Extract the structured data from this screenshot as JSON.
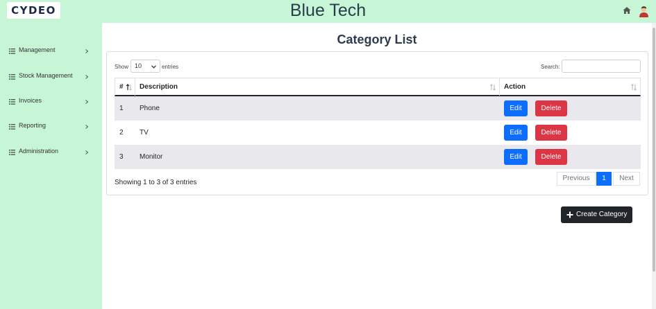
{
  "header": {
    "logo_text": "CYDEO",
    "app_title": "Blue Tech",
    "icons": [
      "home-icon",
      "user-avatar-icon"
    ]
  },
  "sidebar": {
    "items": [
      {
        "label": "Management",
        "icon": "list-icon"
      },
      {
        "label": "Stock Management",
        "icon": "list-icon"
      },
      {
        "label": "Invoices",
        "icon": "list-icon"
      },
      {
        "label": "Reporting",
        "icon": "list-icon"
      },
      {
        "label": "Administration",
        "icon": "list-icon"
      }
    ]
  },
  "main": {
    "page_title": "Category List",
    "length_menu": {
      "show_label": "Show",
      "selected": "10",
      "entries_label": "entries"
    },
    "search": {
      "label": "Search:",
      "value": "",
      "placeholder": ""
    },
    "table": {
      "columns": [
        "#",
        "Description",
        "Action"
      ],
      "rows": [
        {
          "id": "1",
          "description": "Phone"
        },
        {
          "id": "2",
          "description": "TV"
        },
        {
          "id": "3",
          "description": "Monitor"
        }
      ],
      "edit_label": "Edit",
      "delete_label": "Delete"
    },
    "info": "Showing 1 to 3 of 3 entries",
    "pagination": {
      "previous": "Previous",
      "current": "1",
      "next": "Next"
    },
    "create_button": "Create Category"
  },
  "colors": {
    "sidebar_bg": "#c6f6d5",
    "edit": "#0d6efd",
    "delete": "#dc3545",
    "dark_button": "#212529"
  }
}
